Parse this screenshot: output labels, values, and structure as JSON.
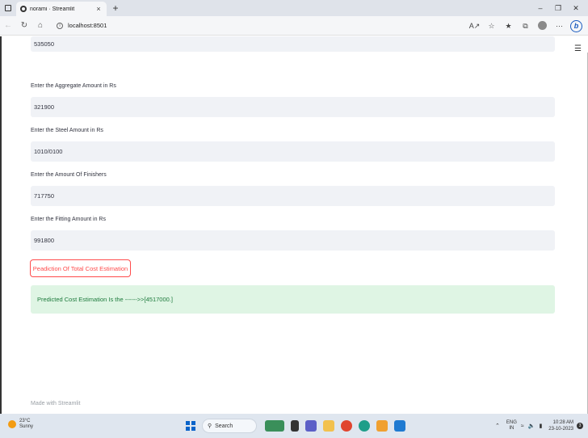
{
  "browser": {
    "tab_title": "norami · Streamlit",
    "tab_close": "×",
    "new_tab": "+",
    "url": "localhost:8501",
    "window_controls": [
      "–",
      "❐",
      "✕"
    ]
  },
  "form": {
    "first_value": "535050",
    "aggregate_label": "Enter the Aggregate Amount in Rs",
    "aggregate_value": "321900",
    "steel_label": "Enter the Steel Amount in Rs",
    "steel_value": "1010/0100",
    "finishers_label": "Enter the Amount Of Finishers",
    "finishers_value": "717750",
    "fitting_label": "Enter the Fitting Amount in Rs",
    "fitting_value": "991800",
    "predict_button": "Peadiction Of Total Cost Estimation",
    "result_text": "Predicted Cost Estimation Is the ------>>[4517000.]"
  },
  "footer": {
    "text": "Made with Streamlit"
  },
  "taskbar": {
    "weather_temp": "23°C",
    "weather_desc": "Sunny",
    "search_label": "Search",
    "lang_1": "ENG",
    "lang_2": "IN",
    "time": "10:28 AM",
    "date": "23-10-2023",
    "notification_count": "3"
  },
  "colors": {
    "accent": "#ff4b4b",
    "success_bg": "#dff5e4",
    "success_text": "#1d7a3c",
    "input_bg": "#f0f2f6"
  }
}
